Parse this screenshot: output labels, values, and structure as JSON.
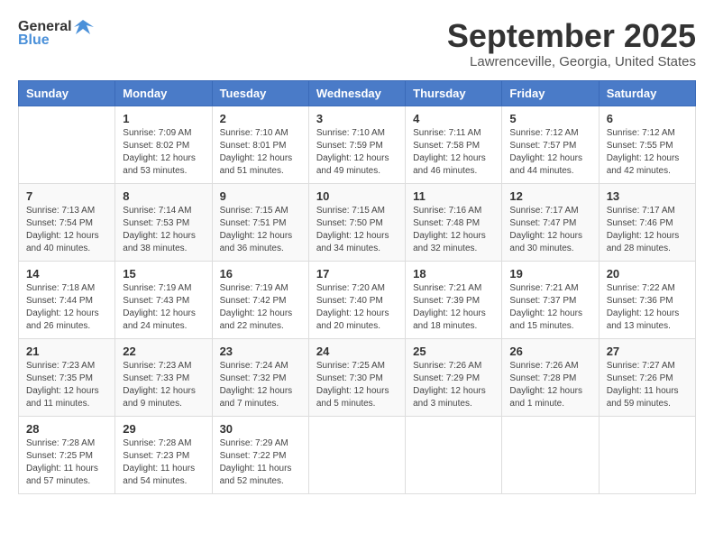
{
  "logo": {
    "general": "General",
    "blue": "Blue"
  },
  "header": {
    "month": "September 2025",
    "location": "Lawrenceville, Georgia, United States"
  },
  "weekdays": [
    "Sunday",
    "Monday",
    "Tuesday",
    "Wednesday",
    "Thursday",
    "Friday",
    "Saturday"
  ],
  "weeks": [
    [
      {
        "day": "",
        "info": ""
      },
      {
        "day": "1",
        "info": "Sunrise: 7:09 AM\nSunset: 8:02 PM\nDaylight: 12 hours\nand 53 minutes."
      },
      {
        "day": "2",
        "info": "Sunrise: 7:10 AM\nSunset: 8:01 PM\nDaylight: 12 hours\nand 51 minutes."
      },
      {
        "day": "3",
        "info": "Sunrise: 7:10 AM\nSunset: 7:59 PM\nDaylight: 12 hours\nand 49 minutes."
      },
      {
        "day": "4",
        "info": "Sunrise: 7:11 AM\nSunset: 7:58 PM\nDaylight: 12 hours\nand 46 minutes."
      },
      {
        "day": "5",
        "info": "Sunrise: 7:12 AM\nSunset: 7:57 PM\nDaylight: 12 hours\nand 44 minutes."
      },
      {
        "day": "6",
        "info": "Sunrise: 7:12 AM\nSunset: 7:55 PM\nDaylight: 12 hours\nand 42 minutes."
      }
    ],
    [
      {
        "day": "7",
        "info": "Sunrise: 7:13 AM\nSunset: 7:54 PM\nDaylight: 12 hours\nand 40 minutes."
      },
      {
        "day": "8",
        "info": "Sunrise: 7:14 AM\nSunset: 7:53 PM\nDaylight: 12 hours\nand 38 minutes."
      },
      {
        "day": "9",
        "info": "Sunrise: 7:15 AM\nSunset: 7:51 PM\nDaylight: 12 hours\nand 36 minutes."
      },
      {
        "day": "10",
        "info": "Sunrise: 7:15 AM\nSunset: 7:50 PM\nDaylight: 12 hours\nand 34 minutes."
      },
      {
        "day": "11",
        "info": "Sunrise: 7:16 AM\nSunset: 7:48 PM\nDaylight: 12 hours\nand 32 minutes."
      },
      {
        "day": "12",
        "info": "Sunrise: 7:17 AM\nSunset: 7:47 PM\nDaylight: 12 hours\nand 30 minutes."
      },
      {
        "day": "13",
        "info": "Sunrise: 7:17 AM\nSunset: 7:46 PM\nDaylight: 12 hours\nand 28 minutes."
      }
    ],
    [
      {
        "day": "14",
        "info": "Sunrise: 7:18 AM\nSunset: 7:44 PM\nDaylight: 12 hours\nand 26 minutes."
      },
      {
        "day": "15",
        "info": "Sunrise: 7:19 AM\nSunset: 7:43 PM\nDaylight: 12 hours\nand 24 minutes."
      },
      {
        "day": "16",
        "info": "Sunrise: 7:19 AM\nSunset: 7:42 PM\nDaylight: 12 hours\nand 22 minutes."
      },
      {
        "day": "17",
        "info": "Sunrise: 7:20 AM\nSunset: 7:40 PM\nDaylight: 12 hours\nand 20 minutes."
      },
      {
        "day": "18",
        "info": "Sunrise: 7:21 AM\nSunset: 7:39 PM\nDaylight: 12 hours\nand 18 minutes."
      },
      {
        "day": "19",
        "info": "Sunrise: 7:21 AM\nSunset: 7:37 PM\nDaylight: 12 hours\nand 15 minutes."
      },
      {
        "day": "20",
        "info": "Sunrise: 7:22 AM\nSunset: 7:36 PM\nDaylight: 12 hours\nand 13 minutes."
      }
    ],
    [
      {
        "day": "21",
        "info": "Sunrise: 7:23 AM\nSunset: 7:35 PM\nDaylight: 12 hours\nand 11 minutes."
      },
      {
        "day": "22",
        "info": "Sunrise: 7:23 AM\nSunset: 7:33 PM\nDaylight: 12 hours\nand 9 minutes."
      },
      {
        "day": "23",
        "info": "Sunrise: 7:24 AM\nSunset: 7:32 PM\nDaylight: 12 hours\nand 7 minutes."
      },
      {
        "day": "24",
        "info": "Sunrise: 7:25 AM\nSunset: 7:30 PM\nDaylight: 12 hours\nand 5 minutes."
      },
      {
        "day": "25",
        "info": "Sunrise: 7:26 AM\nSunset: 7:29 PM\nDaylight: 12 hours\nand 3 minutes."
      },
      {
        "day": "26",
        "info": "Sunrise: 7:26 AM\nSunset: 7:28 PM\nDaylight: 12 hours\nand 1 minute."
      },
      {
        "day": "27",
        "info": "Sunrise: 7:27 AM\nSunset: 7:26 PM\nDaylight: 11 hours\nand 59 minutes."
      }
    ],
    [
      {
        "day": "28",
        "info": "Sunrise: 7:28 AM\nSunset: 7:25 PM\nDaylight: 11 hours\nand 57 minutes."
      },
      {
        "day": "29",
        "info": "Sunrise: 7:28 AM\nSunset: 7:23 PM\nDaylight: 11 hours\nand 54 minutes."
      },
      {
        "day": "30",
        "info": "Sunrise: 7:29 AM\nSunset: 7:22 PM\nDaylight: 11 hours\nand 52 minutes."
      },
      {
        "day": "",
        "info": ""
      },
      {
        "day": "",
        "info": ""
      },
      {
        "day": "",
        "info": ""
      },
      {
        "day": "",
        "info": ""
      }
    ]
  ]
}
